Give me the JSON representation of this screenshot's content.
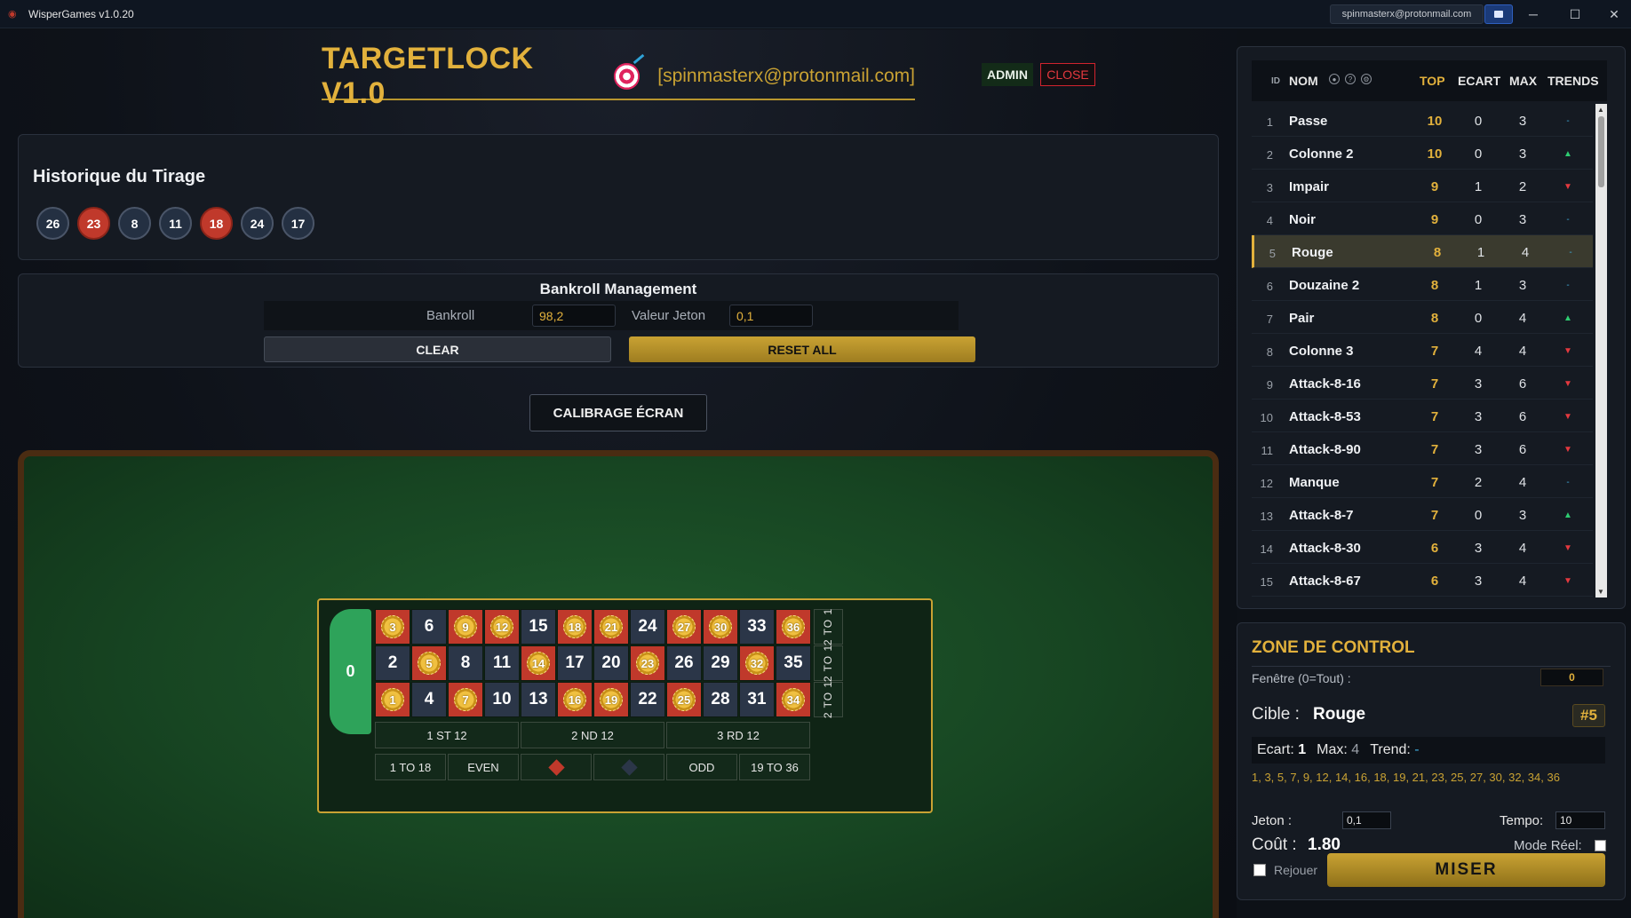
{
  "window": {
    "title": "WisperGames v1.0.20",
    "user_email": "spinmasterx@protonmail.com",
    "minimize": "─",
    "maximize": "☐",
    "close": "✕"
  },
  "header": {
    "title": "TARGETLOCK V1.0",
    "email": "[spinmasterx@protonmail.com]",
    "admin_label": "ADMIN",
    "close_label": "CLOSE"
  },
  "history": {
    "title": "Historique du Tirage",
    "balls": [
      {
        "n": "26",
        "color": "black"
      },
      {
        "n": "23",
        "color": "red"
      },
      {
        "n": "8",
        "color": "black"
      },
      {
        "n": "11",
        "color": "black"
      },
      {
        "n": "18",
        "color": "red"
      },
      {
        "n": "24",
        "color": "black"
      },
      {
        "n": "17",
        "color": "black"
      }
    ]
  },
  "bankroll": {
    "title": "Bankroll Management",
    "bankroll_label": "Bankroll",
    "bankroll_value": "98,2",
    "jeton_label": "Valeur Jeton",
    "jeton_value": "0,1",
    "clear_label": "CLEAR",
    "reset_label": "RESET ALL"
  },
  "calibrage_label": "CALIBRAGE ÉCRAN",
  "roulette": {
    "zero": "0",
    "rows": [
      [
        {
          "n": "3",
          "c": "red",
          "chip": true
        },
        {
          "n": "6",
          "c": "black"
        },
        {
          "n": "9",
          "c": "red",
          "chip": true
        },
        {
          "n": "12",
          "c": "red",
          "chip": true
        },
        {
          "n": "15",
          "c": "black"
        },
        {
          "n": "18",
          "c": "red",
          "chip": true
        },
        {
          "n": "21",
          "c": "red",
          "chip": true
        },
        {
          "n": "24",
          "c": "black"
        },
        {
          "n": "27",
          "c": "red",
          "chip": true
        },
        {
          "n": "30",
          "c": "red",
          "chip": true
        },
        {
          "n": "33",
          "c": "black"
        },
        {
          "n": "36",
          "c": "red",
          "chip": true
        }
      ],
      [
        {
          "n": "2",
          "c": "black"
        },
        {
          "n": "5",
          "c": "red",
          "chip": true
        },
        {
          "n": "8",
          "c": "black"
        },
        {
          "n": "11",
          "c": "black"
        },
        {
          "n": "14",
          "c": "red",
          "chip": true
        },
        {
          "n": "17",
          "c": "black"
        },
        {
          "n": "20",
          "c": "black"
        },
        {
          "n": "23",
          "c": "red",
          "chip": true
        },
        {
          "n": "26",
          "c": "black"
        },
        {
          "n": "29",
          "c": "black"
        },
        {
          "n": "32",
          "c": "red",
          "chip": true
        },
        {
          "n": "35",
          "c": "black"
        }
      ],
      [
        {
          "n": "1",
          "c": "red",
          "chip": true
        },
        {
          "n": "4",
          "c": "black"
        },
        {
          "n": "7",
          "c": "red",
          "chip": true
        },
        {
          "n": "10",
          "c": "black"
        },
        {
          "n": "13",
          "c": "black"
        },
        {
          "n": "16",
          "c": "red",
          "chip": true
        },
        {
          "n": "19",
          "c": "red",
          "chip": true
        },
        {
          "n": "22",
          "c": "black"
        },
        {
          "n": "25",
          "c": "red",
          "chip": true
        },
        {
          "n": "28",
          "c": "black"
        },
        {
          "n": "31",
          "c": "black"
        },
        {
          "n": "34",
          "c": "red",
          "chip": true
        }
      ]
    ],
    "column_label": "2 TO 1",
    "dozens": [
      "1 ST 12",
      "2 ND 12",
      "3 RD 12"
    ],
    "outside": [
      "1 TO 18",
      "EVEN",
      "",
      "",
      "ODD",
      "19 TO 36"
    ],
    "red_color": "#c0392b",
    "black_color": "#2b3648"
  },
  "ranking": {
    "headers": {
      "id": "ID",
      "nom": "NOM",
      "top": "TOP",
      "ecart": "ECART",
      "max": "MAX",
      "trends": "TRENDS"
    },
    "header_icons": [
      "●",
      "?",
      "⚙"
    ],
    "rows": [
      {
        "id": "1",
        "nom": "Passe",
        "top": "10",
        "ecart": "0",
        "max": "3",
        "trend": "flat"
      },
      {
        "id": "2",
        "nom": "Colonne 2",
        "top": "10",
        "ecart": "0",
        "max": "3",
        "trend": "up"
      },
      {
        "id": "3",
        "nom": "Impair",
        "top": "9",
        "ecart": "1",
        "max": "2",
        "trend": "down"
      },
      {
        "id": "4",
        "nom": "Noir",
        "top": "9",
        "ecart": "0",
        "max": "3",
        "trend": "flat"
      },
      {
        "id": "5",
        "nom": "Rouge",
        "top": "8",
        "ecart": "1",
        "max": "4",
        "trend": "flat",
        "selected": true
      },
      {
        "id": "6",
        "nom": "Douzaine 2",
        "top": "8",
        "ecart": "1",
        "max": "3",
        "trend": "flat"
      },
      {
        "id": "7",
        "nom": "Pair",
        "top": "8",
        "ecart": "0",
        "max": "4",
        "trend": "up"
      },
      {
        "id": "8",
        "nom": "Colonne 3",
        "top": "7",
        "ecart": "4",
        "max": "4",
        "trend": "down"
      },
      {
        "id": "9",
        "nom": "Attack-8-16",
        "top": "7",
        "ecart": "3",
        "max": "6",
        "trend": "down"
      },
      {
        "id": "10",
        "nom": "Attack-8-53",
        "top": "7",
        "ecart": "3",
        "max": "6",
        "trend": "down"
      },
      {
        "id": "11",
        "nom": "Attack-8-90",
        "top": "7",
        "ecart": "3",
        "max": "6",
        "trend": "down"
      },
      {
        "id": "12",
        "nom": "Manque",
        "top": "7",
        "ecart": "2",
        "max": "4",
        "trend": "flat"
      },
      {
        "id": "13",
        "nom": "Attack-8-7",
        "top": "7",
        "ecart": "0",
        "max": "3",
        "trend": "up"
      },
      {
        "id": "14",
        "nom": "Attack-8-30",
        "top": "6",
        "ecart": "3",
        "max": "4",
        "trend": "down"
      },
      {
        "id": "15",
        "nom": "Attack-8-67",
        "top": "6",
        "ecart": "3",
        "max": "4",
        "trend": "down"
      }
    ],
    "trend_symbols": {
      "up": "▲",
      "down": "▼",
      "flat": "-"
    }
  },
  "control": {
    "title": "ZONE DE CONTROL",
    "fenetre_label": "Fenêtre (0=Tout) :",
    "fenetre_value": "0",
    "cible_label": "Cible :",
    "cible_value": "Rouge",
    "cible_id": "#5",
    "ecart_label": "Ecart:",
    "ecart_value": "1",
    "max_label": "Max:",
    "max_value": "4",
    "trend_label": "Trend:",
    "trend_value": "-",
    "numbers": "1, 3, 5, 7, 9, 12, 14, 16, 18, 19, 21, 23, 25, 27, 30, 32, 34, 36",
    "jeton_label": "Jeton :",
    "jeton_value": "0,1",
    "tempo_label": "Tempo:",
    "tempo_value": "10",
    "cout_label": "Coût :",
    "cout_value": "1.80",
    "mode_label": "Mode Réel:",
    "rejouer_label": "Rejouer",
    "miser_label": "MISER"
  }
}
